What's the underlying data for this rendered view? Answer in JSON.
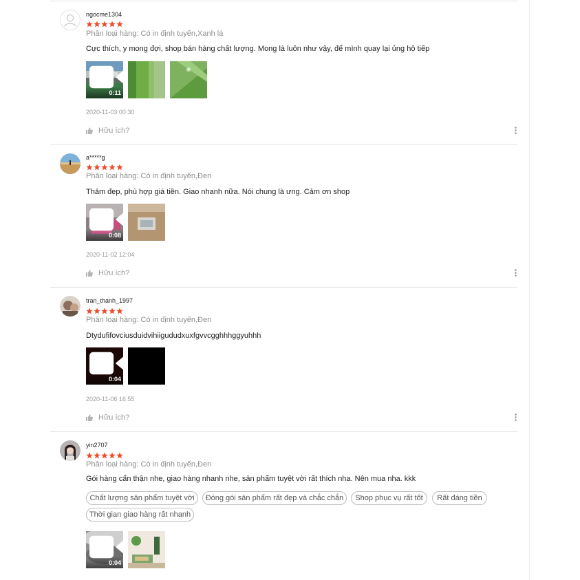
{
  "colors": {
    "star": "#ee4d2d",
    "text": "#222222",
    "muted": "#8c8c8c",
    "divider": "#e2e2e2",
    "tag_border": "#bdbdbd"
  },
  "helpful_label": "Hữu ích?",
  "reviews": [
    {
      "author": "ngocme1304",
      "avatar": "default-user-icon",
      "rating": 5,
      "variation": "Phân loại hàng: Có in định tuyến,Xanh lá",
      "comment": "Cực thích, y mong đợi, shop bán hàng chất lượng. Mong là luôn như vậy, để mình quay lại ủng hộ tiếp",
      "media": [
        {
          "kind": "video",
          "duration": "0:11",
          "scene": "green-fabric-outdoor"
        },
        {
          "kind": "image",
          "scene": "green-fabric"
        },
        {
          "kind": "image",
          "scene": "green-fabric-fold"
        }
      ],
      "date": "2020-11-03 00:30"
    },
    {
      "author": "a*****g",
      "avatar": "desert-landscape-photo",
      "rating": 5,
      "variation": "Phân loại hàng: Có in định tuyến,Đen",
      "comment": "Thảm đẹp, phù hợp giá tiền. Giao nhanh nữa. Nói chung là ưng. Cảm ơn shop",
      "media": [
        {
          "kind": "video",
          "duration": "0:08",
          "scene": "pink-package"
        },
        {
          "kind": "image",
          "scene": "package-box"
        }
      ],
      "date": "2020-11-02 12:04"
    },
    {
      "author": "tran_thanh_1997",
      "avatar": "person-portrait-photo",
      "rating": 5,
      "variation": "Phân loại hàng: Có in định tuyến,Đen",
      "comment": "Dtydufifovciusduidvihiigududxuxfgvvcgghhhggyuhhh",
      "media": [
        {
          "kind": "video",
          "duration": "0:04",
          "scene": "dark"
        },
        {
          "kind": "image",
          "scene": "black"
        }
      ],
      "date": "2020-11-06 16:55"
    },
    {
      "author": "yin2707",
      "avatar": "person-portrait-photo",
      "rating": 5,
      "variation": "Phân loại hàng: Có in định tuyến,Đen",
      "comment": "Gói hàng cẩn thận nhe, giao hàng nhanh nhe, sản phẩm tuyệt vời rất thích nha. Nên mua nha. kkk",
      "tags": [
        "Chất lượng sản phẩm tuyệt vời",
        "Đóng gói sản phẩm rất đẹp và chắc chắn",
        "Shop phục vụ rất tốt",
        "Rất đáng tiền",
        "Thời gian giao hàng rất nhanh"
      ],
      "media": [
        {
          "kind": "video",
          "duration": "0:04",
          "scene": "grey-surface"
        },
        {
          "kind": "image",
          "scene": "room-with-plant"
        }
      ]
    }
  ]
}
